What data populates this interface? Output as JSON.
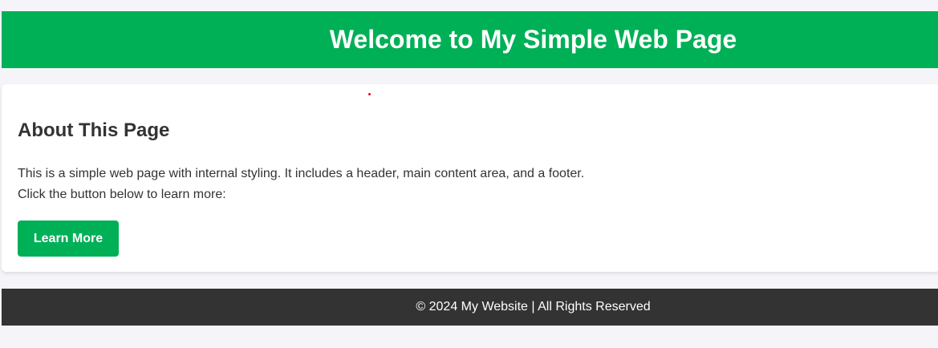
{
  "header": {
    "title": "Welcome to My Simple Web Page"
  },
  "main": {
    "heading": "About This Page",
    "paragraph_line1": "This is a simple web page with internal styling. It includes a header, main content area, and a footer.",
    "paragraph_line2": "Click the button below to learn more:",
    "button_label": "Learn More"
  },
  "footer": {
    "text": "© 2024 My Website | All Rights Reserved"
  },
  "colors": {
    "accent": "#00b057",
    "footer_bg": "#333333",
    "page_bg": "#f4f4f9",
    "text": "#333333",
    "marker": "#e8001c"
  }
}
